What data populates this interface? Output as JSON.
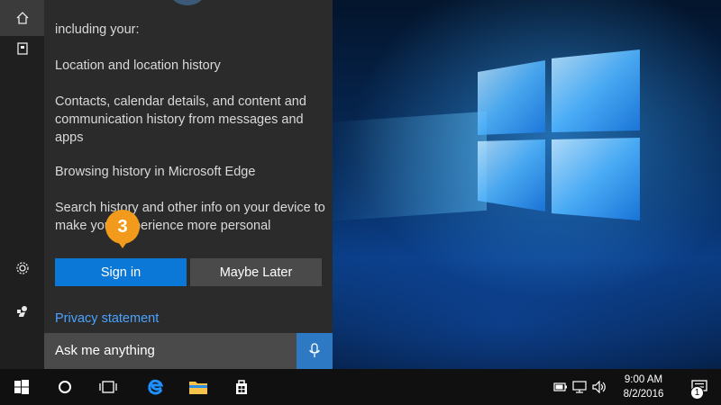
{
  "cortana": {
    "intro_fragment": "including your:",
    "items": [
      "Location and location history",
      "Contacts, calendar details, and content and communication history from messages and apps",
      "Browsing history in Microsoft Edge",
      "Search history and other info on your device to make your experience more personal"
    ],
    "sign_in_label": "Sign in",
    "maybe_later_label": "Maybe Later",
    "privacy_label": "Privacy statement",
    "search_placeholder": "Ask me anything"
  },
  "callout": {
    "step": "3"
  },
  "rail": {
    "icons": [
      "home-icon",
      "notebook-icon",
      "settings-icon",
      "feedback-icon"
    ]
  },
  "taskbar": {
    "icons": [
      "windows-start-icon",
      "cortana-circle-icon",
      "task-view-icon",
      "edge-icon",
      "file-explorer-icon",
      "store-icon"
    ],
    "tray_icons": [
      "battery-icon",
      "network-icon",
      "volume-icon"
    ],
    "time": "9:00 AM",
    "date": "8/2/2016",
    "notification_count": "1"
  },
  "colors": {
    "accent": "#0b78d7",
    "callout": "#f29a1c",
    "link": "#4aa3ff",
    "panel": "#2b2b2b"
  }
}
